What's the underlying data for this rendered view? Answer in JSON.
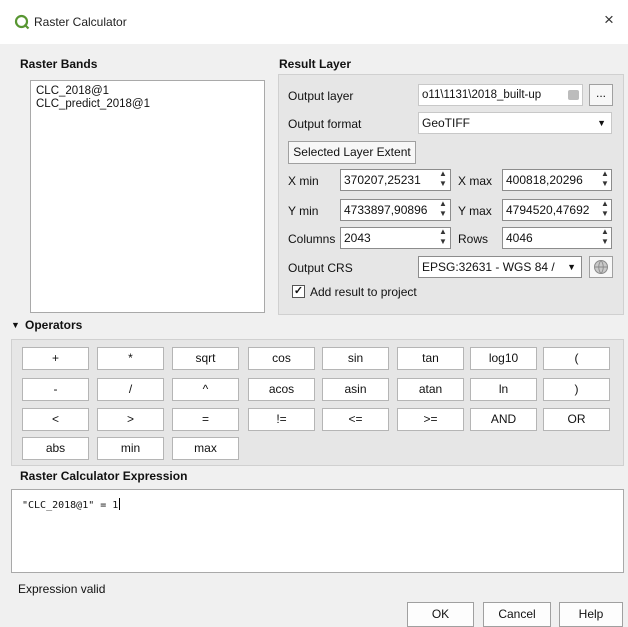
{
  "window": {
    "title": "Raster Calculator",
    "close_glyph": "×",
    "icon": "qgis-icon"
  },
  "raster_bands": {
    "heading": "Raster Bands",
    "items": [
      "CLC_2018@1",
      "CLC_predict_2018@1"
    ]
  },
  "result_layer": {
    "heading": "Result Layer",
    "output_layer_label": "Output layer",
    "output_layer_value": "o11\\1131\\2018_built-up",
    "browse_label": "...",
    "output_format_label": "Output format",
    "output_format_value": "GeoTIFF",
    "selected_extent_label": "Selected Layer Extent",
    "xmin_label": "X min",
    "xmin_value": "370207,25231",
    "xmax_label": "X max",
    "xmax_value": "400818,20296",
    "ymin_label": "Y min",
    "ymin_value": "4733897,90896",
    "ymax_label": "Y max",
    "ymax_value": "4794520,47692",
    "columns_label": "Columns",
    "columns_value": "2043",
    "rows_label": "Rows",
    "rows_value": "4046",
    "crs_label": "Output CRS",
    "crs_value": "EPSG:32631 - WGS 84 /",
    "add_result_label": "Add result to project",
    "add_result_checked": true
  },
  "operators": {
    "heading": "Operators",
    "rows": [
      [
        "+",
        "*",
        "sqrt",
        "cos",
        "sin",
        "tan",
        "log10",
        "("
      ],
      [
        "-",
        "/",
        "^",
        "acos",
        "asin",
        "atan",
        "ln",
        ")"
      ],
      [
        "<",
        ">",
        "=",
        "!=",
        "<=",
        ">=",
        "AND",
        "OR"
      ],
      [
        "abs",
        "min",
        "max"
      ]
    ]
  },
  "expression": {
    "heading": "Raster Calculator Expression",
    "value": "\"CLC_2018@1\" = 1",
    "status": "Expression valid"
  },
  "buttons": {
    "ok": "OK",
    "cancel": "Cancel",
    "help": "Help"
  },
  "colors": {
    "background": "#f0f0f0",
    "panel": "#e6e6e6",
    "field": "#ffffff",
    "qgis_green": "#589632"
  }
}
